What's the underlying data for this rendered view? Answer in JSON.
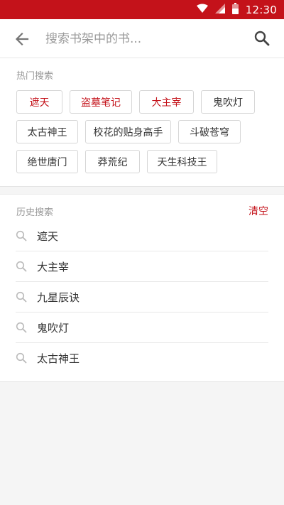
{
  "status_bar": {
    "time": "12:30",
    "icons": [
      "wifi-icon",
      "cell-signal-icon",
      "battery-icon"
    ]
  },
  "search": {
    "placeholder": "搜索书架中的书...",
    "value": ""
  },
  "hot": {
    "title": "热门搜索",
    "tags": [
      {
        "label": "遮天",
        "highlight": true
      },
      {
        "label": "盗墓笔记",
        "highlight": true
      },
      {
        "label": "大主宰",
        "highlight": true
      },
      {
        "label": "鬼吹灯",
        "highlight": false
      },
      {
        "label": "太古神王",
        "highlight": false
      },
      {
        "label": "校花的贴身高手",
        "highlight": false
      },
      {
        "label": "斗破苍穹",
        "highlight": false
      },
      {
        "label": "绝世唐门",
        "highlight": false
      },
      {
        "label": "莽荒纪",
        "highlight": false
      },
      {
        "label": "天生科技王",
        "highlight": false
      }
    ]
  },
  "history": {
    "title": "历史搜索",
    "clear_label": "清空",
    "items": [
      "遮天",
      "大主宰",
      "九星辰诀",
      "鬼吹灯",
      "太古神王"
    ]
  },
  "colors": {
    "accent": "#c4121a",
    "muted_text": "#999999",
    "page_bg": "#f5f5f5"
  }
}
